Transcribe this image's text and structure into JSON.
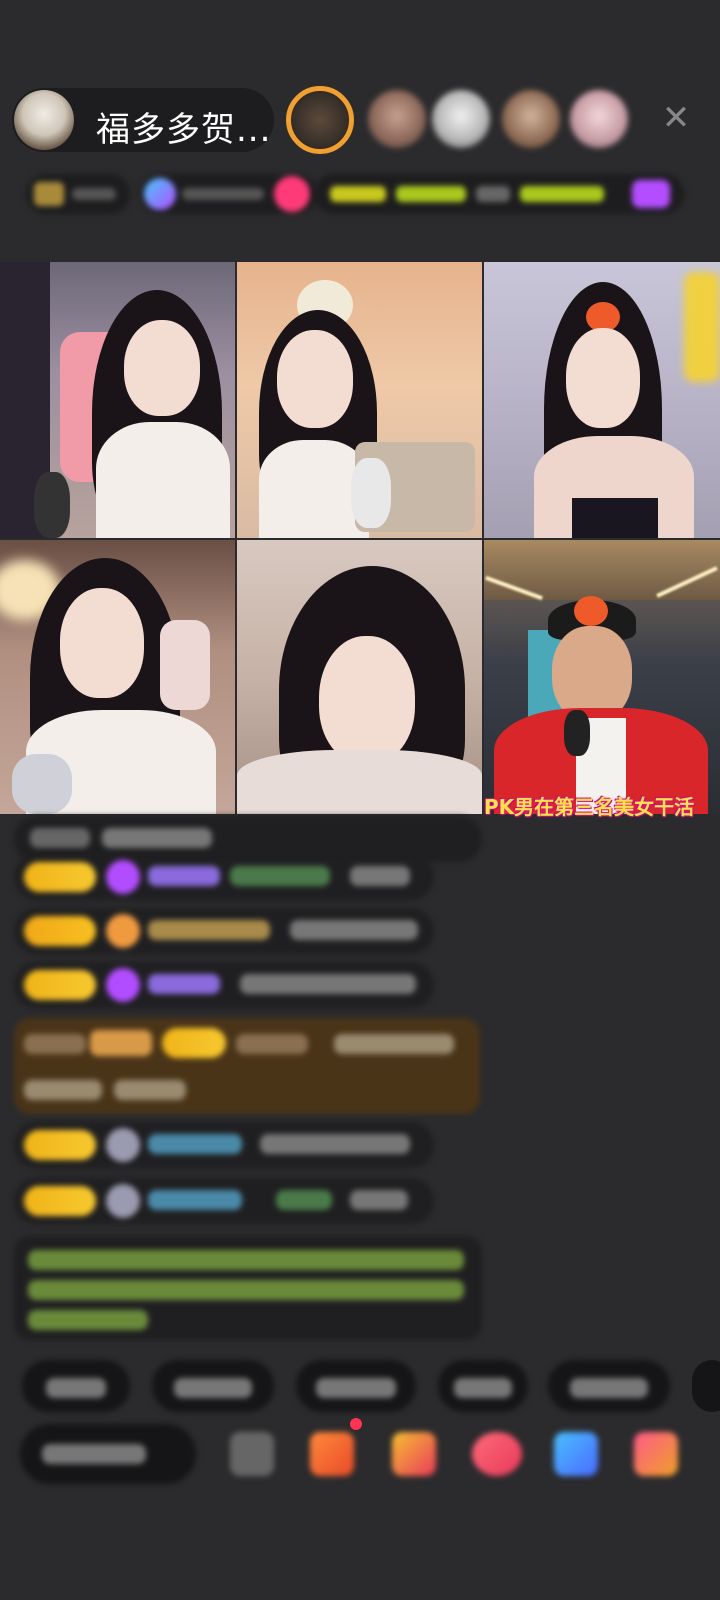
{
  "header": {
    "host_name": "福多多贺...",
    "viewers": [
      "viewer-1",
      "viewer-2",
      "viewer-3",
      "viewer-4",
      "viewer-5"
    ],
    "close_symbol": "✕"
  },
  "video_grid": {
    "tiles": [
      "tile-1",
      "tile-2",
      "tile-3",
      "tile-4",
      "tile-5",
      "tile-6"
    ],
    "caption": "PK男在第三名美女干活"
  },
  "colors": {
    "background": "#2b2b2d",
    "badge_gold": "#f0b418",
    "caption_yellow": "#ffe14a",
    "gem_purple": "#b24dff"
  },
  "icons": {
    "close": "close-icon",
    "gem": "gem-icon",
    "gift": "gift-icon",
    "more": "more-icon"
  }
}
